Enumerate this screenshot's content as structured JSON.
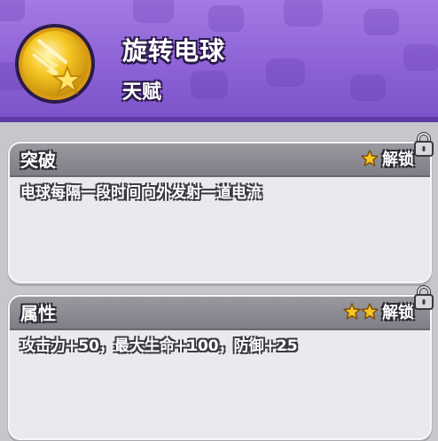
{
  "skill": {
    "name": "旋转电球",
    "type": "天赋",
    "icon": "electric-orb-icon",
    "icon_colors": {
      "gold": "#f5c623",
      "rim": "#c48a0c"
    }
  },
  "header": {
    "bg_color": "#8c62d6"
  },
  "cards": [
    {
      "title": "突破",
      "unlock_label": "解锁",
      "stars": 1,
      "description": "电球每隔一段时间向外发射一道电流",
      "locked": true
    },
    {
      "title": "属性",
      "unlock_label": "解锁",
      "stars": 2,
      "description": "攻击力+50，最大生命+100，防御+25",
      "locked": true
    }
  ],
  "colors": {
    "star": "#f7c623",
    "card_bg": "#ebe9ee",
    "card_head": "#8a888f"
  }
}
